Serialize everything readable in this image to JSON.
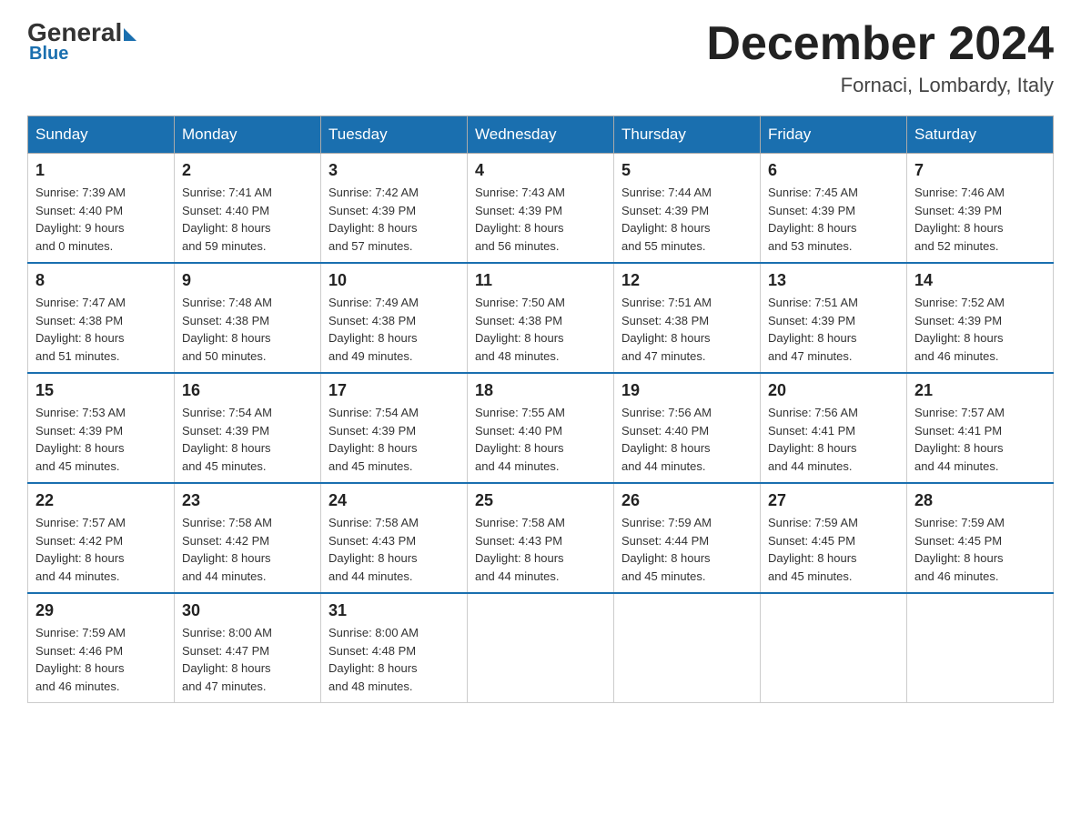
{
  "header": {
    "logo_general": "General",
    "logo_blue": "Blue",
    "month_title": "December 2024",
    "location": "Fornaci, Lombardy, Italy"
  },
  "days_of_week": [
    "Sunday",
    "Monday",
    "Tuesday",
    "Wednesday",
    "Thursday",
    "Friday",
    "Saturday"
  ],
  "weeks": [
    [
      {
        "day": "1",
        "sunrise": "7:39 AM",
        "sunset": "4:40 PM",
        "daylight": "9 hours and 0 minutes."
      },
      {
        "day": "2",
        "sunrise": "7:41 AM",
        "sunset": "4:40 PM",
        "daylight": "8 hours and 59 minutes."
      },
      {
        "day": "3",
        "sunrise": "7:42 AM",
        "sunset": "4:39 PM",
        "daylight": "8 hours and 57 minutes."
      },
      {
        "day": "4",
        "sunrise": "7:43 AM",
        "sunset": "4:39 PM",
        "daylight": "8 hours and 56 minutes."
      },
      {
        "day": "5",
        "sunrise": "7:44 AM",
        "sunset": "4:39 PM",
        "daylight": "8 hours and 55 minutes."
      },
      {
        "day": "6",
        "sunrise": "7:45 AM",
        "sunset": "4:39 PM",
        "daylight": "8 hours and 53 minutes."
      },
      {
        "day": "7",
        "sunrise": "7:46 AM",
        "sunset": "4:39 PM",
        "daylight": "8 hours and 52 minutes."
      }
    ],
    [
      {
        "day": "8",
        "sunrise": "7:47 AM",
        "sunset": "4:38 PM",
        "daylight": "8 hours and 51 minutes."
      },
      {
        "day": "9",
        "sunrise": "7:48 AM",
        "sunset": "4:38 PM",
        "daylight": "8 hours and 50 minutes."
      },
      {
        "day": "10",
        "sunrise": "7:49 AM",
        "sunset": "4:38 PM",
        "daylight": "8 hours and 49 minutes."
      },
      {
        "day": "11",
        "sunrise": "7:50 AM",
        "sunset": "4:38 PM",
        "daylight": "8 hours and 48 minutes."
      },
      {
        "day": "12",
        "sunrise": "7:51 AM",
        "sunset": "4:38 PM",
        "daylight": "8 hours and 47 minutes."
      },
      {
        "day": "13",
        "sunrise": "7:51 AM",
        "sunset": "4:39 PM",
        "daylight": "8 hours and 47 minutes."
      },
      {
        "day": "14",
        "sunrise": "7:52 AM",
        "sunset": "4:39 PM",
        "daylight": "8 hours and 46 minutes."
      }
    ],
    [
      {
        "day": "15",
        "sunrise": "7:53 AM",
        "sunset": "4:39 PM",
        "daylight": "8 hours and 45 minutes."
      },
      {
        "day": "16",
        "sunrise": "7:54 AM",
        "sunset": "4:39 PM",
        "daylight": "8 hours and 45 minutes."
      },
      {
        "day": "17",
        "sunrise": "7:54 AM",
        "sunset": "4:39 PM",
        "daylight": "8 hours and 45 minutes."
      },
      {
        "day": "18",
        "sunrise": "7:55 AM",
        "sunset": "4:40 PM",
        "daylight": "8 hours and 44 minutes."
      },
      {
        "day": "19",
        "sunrise": "7:56 AM",
        "sunset": "4:40 PM",
        "daylight": "8 hours and 44 minutes."
      },
      {
        "day": "20",
        "sunrise": "7:56 AM",
        "sunset": "4:41 PM",
        "daylight": "8 hours and 44 minutes."
      },
      {
        "day": "21",
        "sunrise": "7:57 AM",
        "sunset": "4:41 PM",
        "daylight": "8 hours and 44 minutes."
      }
    ],
    [
      {
        "day": "22",
        "sunrise": "7:57 AM",
        "sunset": "4:42 PM",
        "daylight": "8 hours and 44 minutes."
      },
      {
        "day": "23",
        "sunrise": "7:58 AM",
        "sunset": "4:42 PM",
        "daylight": "8 hours and 44 minutes."
      },
      {
        "day": "24",
        "sunrise": "7:58 AM",
        "sunset": "4:43 PM",
        "daylight": "8 hours and 44 minutes."
      },
      {
        "day": "25",
        "sunrise": "7:58 AM",
        "sunset": "4:43 PM",
        "daylight": "8 hours and 44 minutes."
      },
      {
        "day": "26",
        "sunrise": "7:59 AM",
        "sunset": "4:44 PM",
        "daylight": "8 hours and 45 minutes."
      },
      {
        "day": "27",
        "sunrise": "7:59 AM",
        "sunset": "4:45 PM",
        "daylight": "8 hours and 45 minutes."
      },
      {
        "day": "28",
        "sunrise": "7:59 AM",
        "sunset": "4:45 PM",
        "daylight": "8 hours and 46 minutes."
      }
    ],
    [
      {
        "day": "29",
        "sunrise": "7:59 AM",
        "sunset": "4:46 PM",
        "daylight": "8 hours and 46 minutes."
      },
      {
        "day": "30",
        "sunrise": "8:00 AM",
        "sunset": "4:47 PM",
        "daylight": "8 hours and 47 minutes."
      },
      {
        "day": "31",
        "sunrise": "8:00 AM",
        "sunset": "4:48 PM",
        "daylight": "8 hours and 48 minutes."
      },
      null,
      null,
      null,
      null
    ]
  ],
  "labels": {
    "sunrise": "Sunrise:",
    "sunset": "Sunset:",
    "daylight": "Daylight:"
  }
}
